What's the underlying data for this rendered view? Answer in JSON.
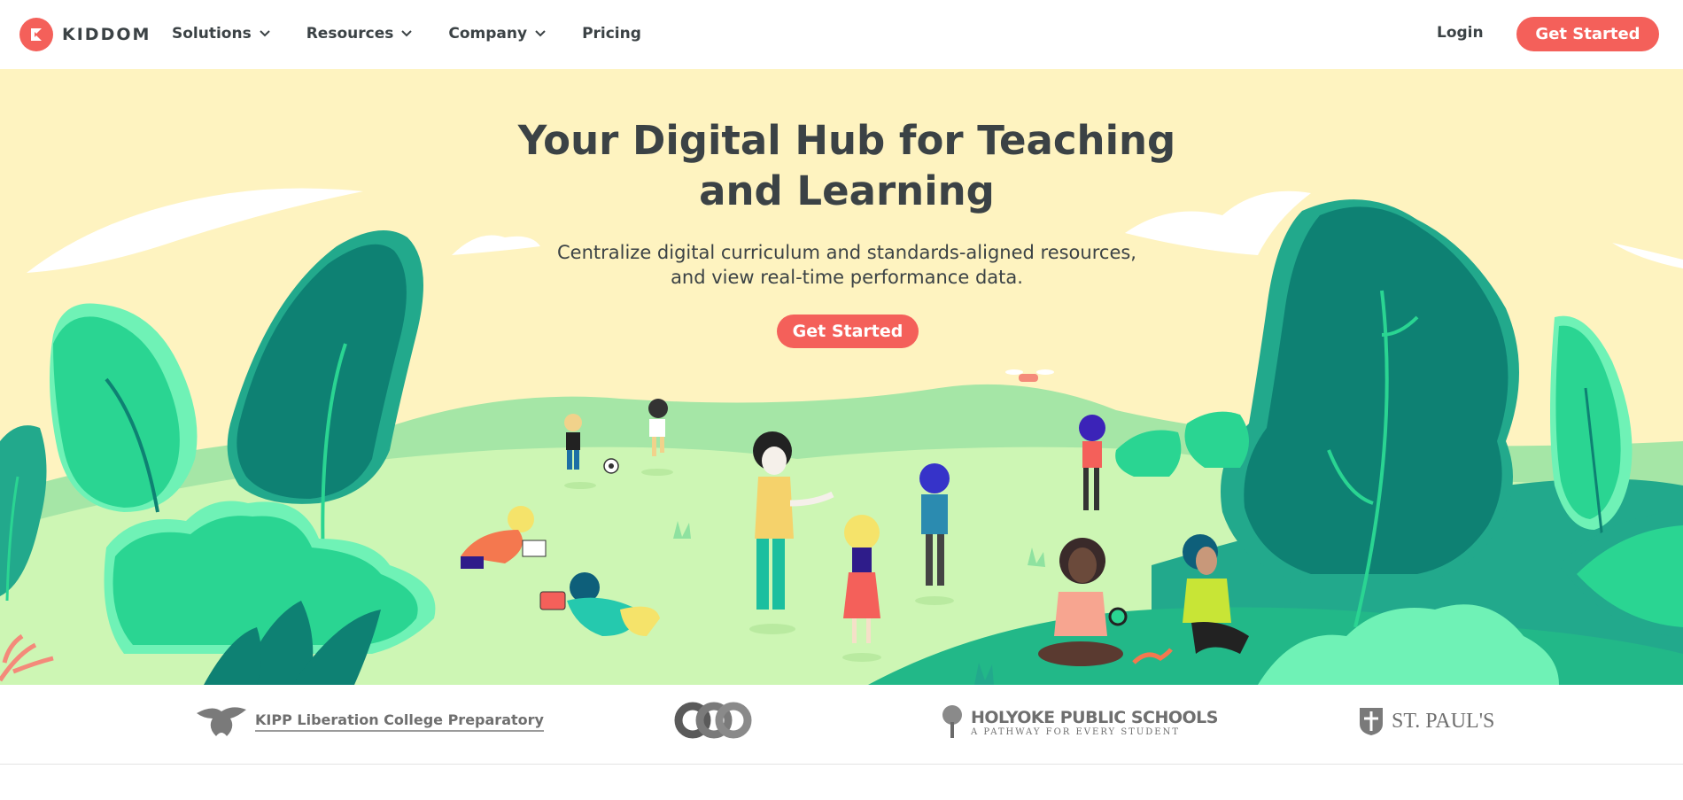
{
  "nav": {
    "brand": "KIDDOM",
    "links": [
      {
        "label": "Solutions",
        "dropdown": true
      },
      {
        "label": "Resources",
        "dropdown": true
      },
      {
        "label": "Company",
        "dropdown": true
      },
      {
        "label": "Pricing",
        "dropdown": false
      }
    ],
    "login": "Login",
    "cta": "Get Started"
  },
  "hero": {
    "title_line1": "Your Digital Hub for Teaching",
    "title_line2": "and Learning",
    "subtitle_line1": "Centralize digital curriculum and standards-aligned resources,",
    "subtitle_line2": "and view real-time performance data.",
    "cta": "Get Started"
  },
  "partners": {
    "kipp_mark": "KIPP",
    "kipp_name": "Liberation College Preparatory",
    "eco": "eco",
    "holyoke_name": "HOLYOKE PUBLIC SCHOOLS",
    "holyoke_tag": "A PATHWAY FOR EVERY STUDENT",
    "stpauls": "ST. PAUL'S"
  },
  "colors": {
    "accent": "#f4605a",
    "hero_bg": "#fef3c0",
    "text": "#3b4245",
    "tree_dark": "#0e8173",
    "tree_mid": "#25c28a",
    "grass_light": "#cdf6b4"
  }
}
